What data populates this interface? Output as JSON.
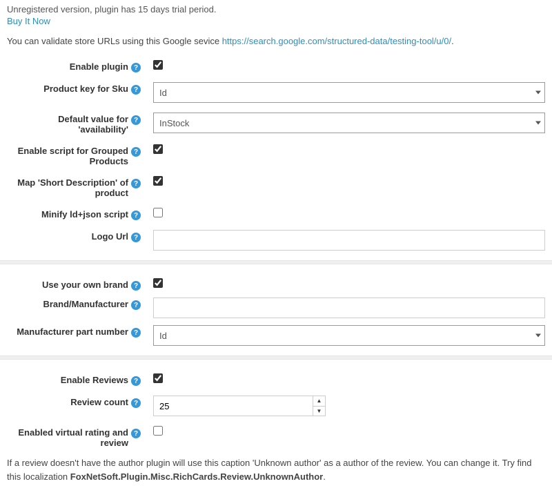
{
  "header": {
    "trial_text": "Unregistered version, plugin has 15 days trial period.",
    "buy_link": "Buy It Now",
    "validate_prefix": "You can validate store URLs using this Google sevice ",
    "validate_url": "https://search.google.com/structured-data/testing-tool/u/0/",
    "validate_suffix": "."
  },
  "section1": {
    "enable_plugin": {
      "label": "Enable plugin",
      "checked": true
    },
    "product_key": {
      "label": "Product key for Sku",
      "value": "Id"
    },
    "default_availability": {
      "label": "Default value for 'availability'",
      "value": "InStock"
    },
    "enable_grouped": {
      "label": "Enable script for Grouped Products",
      "checked": true
    },
    "map_short_desc": {
      "label": "Map 'Short Description' of product",
      "checked": true
    },
    "minify": {
      "label": "Minify ld+json script",
      "checked": false
    },
    "logo_url": {
      "label": "Logo Url",
      "value": ""
    }
  },
  "section2": {
    "own_brand": {
      "label": "Use your own brand",
      "checked": true
    },
    "brand_manuf": {
      "label": "Brand/Manufacturer",
      "value": ""
    },
    "manuf_part": {
      "label": "Manufacturer part number",
      "value": "Id"
    }
  },
  "section3": {
    "enable_reviews": {
      "label": "Enable Reviews",
      "checked": true
    },
    "review_count": {
      "label": "Review count",
      "value": "25"
    },
    "virtual_rating": {
      "label": "Enabled virtual rating and review",
      "checked": false
    },
    "note_prefix": "If a review doesn't have the author plugin will use this caption 'Unknown author' as a author of the review. You can change it. Try find this localization ",
    "note_key": "FoxNetSoft.Plugin.Misc.RichCards.Review.UnknownAuthor",
    "note_suffix": "."
  }
}
